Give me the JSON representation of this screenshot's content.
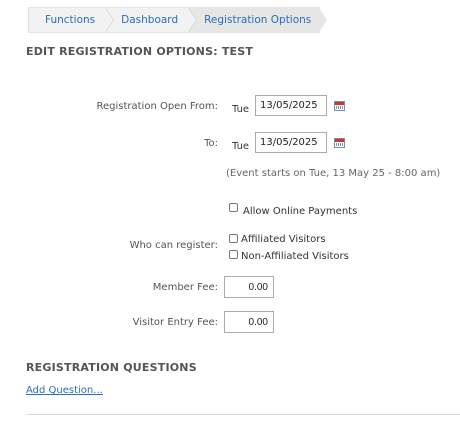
{
  "breadcrumb": {
    "items": [
      "Functions",
      "Dashboard",
      "Registration Options"
    ]
  },
  "page_title": "EDIT REGISTRATION OPTIONS: TEST",
  "form": {
    "open_from_label": "Registration Open From:",
    "open_from_day": "Tue",
    "open_from_date": "13/05/2025",
    "to_label": "To:",
    "to_day": "Tue",
    "to_date": "13/05/2025",
    "event_note": "(Event starts on Tue, 13 May 25 - 8:00 am)",
    "allow_online_payments_label": "Allow Online Payments",
    "who_can_register_label": "Who can register:",
    "affiliated_label": "Affiliated Visitors",
    "non_affiliated_label": "Non-Affiliated Visitors",
    "member_fee_label": "Member Fee:",
    "member_fee_value": "0.00",
    "visitor_fee_label": "Visitor Entry Fee:",
    "visitor_fee_value": "0.00"
  },
  "questions": {
    "heading": "REGISTRATION QUESTIONS",
    "add_link": "Add Question..."
  },
  "colors": {
    "link": "#2a6db8",
    "text": "#555555"
  }
}
